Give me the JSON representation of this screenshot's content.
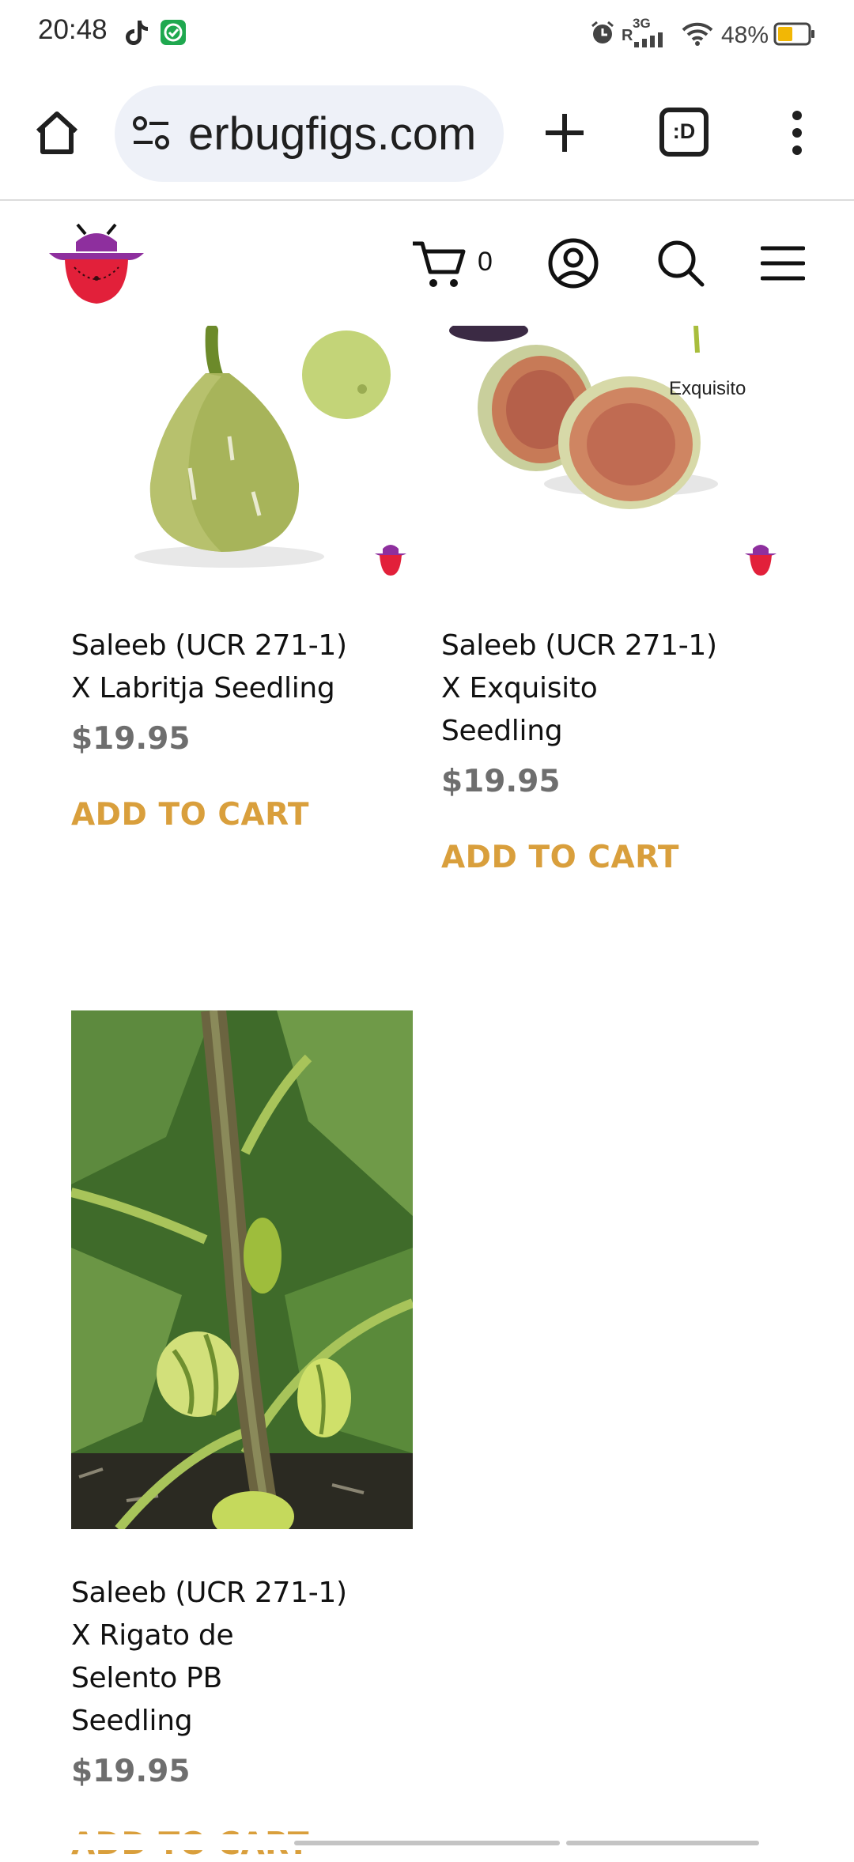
{
  "status_bar": {
    "time": "20:48",
    "network": "3G",
    "roaming": "R",
    "battery": "48%",
    "icons": [
      "tiktok-icon",
      "app-notification-icon",
      "alarm-icon",
      "signal-icon",
      "wifi-icon",
      "battery-icon"
    ]
  },
  "browser": {
    "url": "erbugfigs.com",
    "tab_count_label": ":D",
    "icons": [
      "home-icon",
      "site-info-icon",
      "new-tab-icon",
      "tabs-icon",
      "more-menu-icon"
    ]
  },
  "site": {
    "cart_count": "0",
    "icons": [
      "site-logo",
      "cart-icon",
      "account-icon",
      "search-icon",
      "hamburger-menu-icon"
    ],
    "colors": {
      "logo_purple": "#8e2f9e",
      "logo_red": "#e2203a",
      "accent": "#d99f3c",
      "price": "#6e6e6e"
    }
  },
  "products": [
    {
      "title_lines": [
        "Saleeb (UCR 271-1)",
        "X Labritja Seedling"
      ],
      "price": "$19.95",
      "cta": "ADD TO CART"
    },
    {
      "image_label": "Exquisito",
      "title_lines": [
        "Saleeb (UCR 271-1)",
        "X Exquisito",
        "Seedling"
      ],
      "price": "$19.95",
      "cta": "ADD TO CART"
    },
    {
      "title_lines": [
        "Saleeb (UCR 271-1)",
        "X Rigato de",
        "Selento PB",
        "Seedling"
      ],
      "price": "$19.95",
      "cta": "ADD TO CART"
    }
  ]
}
